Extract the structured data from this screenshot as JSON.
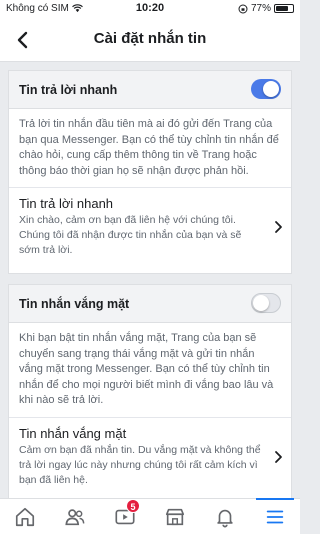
{
  "status_bar": {
    "carrier": "Không có SIM",
    "time": "10:20",
    "battery_text": "77%",
    "battery_level": 0.77
  },
  "nav": {
    "title": "Cài đặt nhắn tin",
    "back_icon": "chevron-left-icon"
  },
  "instant_reply": {
    "toggle_label": "Tin trả lời nhanh",
    "toggle_on": true,
    "description": "Trả lời tin nhắn đầu tiên mà ai đó gửi đến Trang của bạn qua Messenger. Bạn có thể tùy chỉnh tin nhắn để chào hỏi, cung cấp thêm thông tin về Trang hoặc thông báo thời gian họ sẽ nhận được phản hồi.",
    "item_title": "Tin trả lời nhanh",
    "item_text": "Xin chào, cảm ơn bạn đã liên hệ với chúng tôi. Chúng tôi đã nhận được tin nhắn của bạn và sẽ sớm trả lời."
  },
  "away_message": {
    "toggle_label": "Tin nhắn vắng mặt",
    "toggle_on": false,
    "description": "Khi bạn bật tin nhắn vắng mặt, Trang của bạn sẽ chuyển sang trạng thái vắng mặt và gửi tin nhắn vắng mặt trong Messenger. Bạn có thể tùy chỉnh tin nhắn để cho mọi người biết mình đi vắng bao lâu và khi nào sẽ trả lời.",
    "item_title": "Tin nhắn vắng mặt",
    "item_text": "Cảm ơn bạn đã nhắn tin. Du vắng mặt và không thể trả lời ngay lúc này nhưng chúng tôi rất cảm kích vì bạn đã liên hệ."
  },
  "tab_bar": {
    "tabs": [
      "home-icon",
      "friends-icon",
      "watch-icon",
      "marketplace-icon",
      "notifications-icon",
      "menu-icon"
    ],
    "watch_badge": "5",
    "accent_color": "#1877f2"
  }
}
